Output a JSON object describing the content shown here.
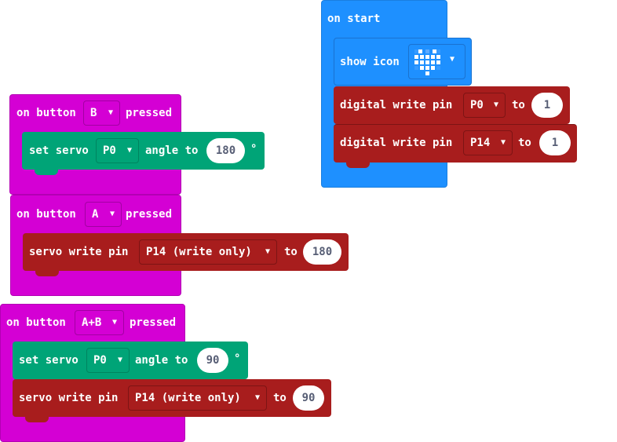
{
  "colors": {
    "basic": "#1e90ff",
    "input": "#d400d4",
    "pins": "#a81d1d",
    "servo": "#00a4a6",
    "white": "#ffffff"
  },
  "start_block": {
    "hat_label": "on start",
    "show_icon": {
      "label": "show icon",
      "icon": "heart-icon"
    },
    "rows": [
      {
        "label": "digital write pin",
        "pin": "P0",
        "to": "to",
        "value": "1"
      },
      {
        "label": "digital write pin",
        "pin": "P14",
        "to": "to",
        "value": "1"
      }
    ]
  },
  "button_b": {
    "label": "on button",
    "button": "B",
    "pressed": "pressed",
    "servo": {
      "label": "set servo",
      "pin": "P0",
      "angle_label": "angle to",
      "value": "180",
      "unit": "°"
    }
  },
  "button_a": {
    "label": "on button",
    "button": "A",
    "pressed": "pressed",
    "servo_write": {
      "label": "servo write pin",
      "pin": "P14 (write only)",
      "to": "to",
      "value": "180"
    }
  },
  "button_ab": {
    "label": "on button",
    "button": "A+B",
    "pressed": "pressed",
    "servo": {
      "label": "set servo",
      "pin": "P0",
      "angle_label": "angle to",
      "value": "90",
      "unit": "°"
    },
    "servo_write": {
      "label": "servo write pin",
      "pin": "P14 (write only)",
      "to": "to",
      "value": "90"
    }
  }
}
